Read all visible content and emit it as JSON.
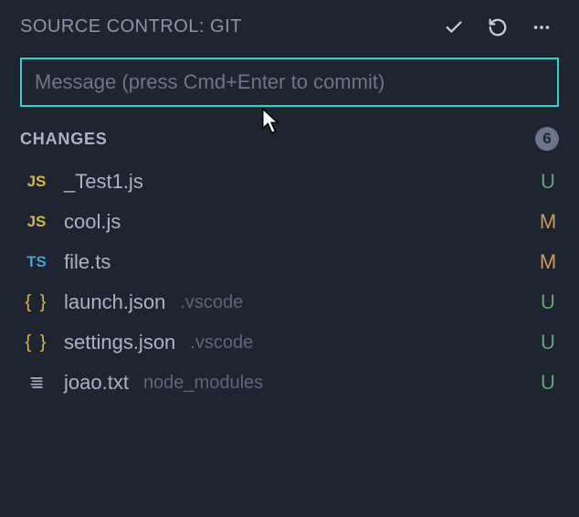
{
  "header": {
    "title": "SOURCE CONTROL: GIT"
  },
  "commit": {
    "placeholder": "Message (press Cmd+Enter to commit)",
    "value": ""
  },
  "changes": {
    "title": "CHANGES",
    "count": "6",
    "files": [
      {
        "icon": "JS",
        "iconType": "js",
        "name": "_Test1.js",
        "path": "",
        "status": "U",
        "statusType": "u"
      },
      {
        "icon": "JS",
        "iconType": "js",
        "name": "cool.js",
        "path": "",
        "status": "M",
        "statusType": "m"
      },
      {
        "icon": "TS",
        "iconType": "ts",
        "name": "file.ts",
        "path": "",
        "status": "M",
        "statusType": "m"
      },
      {
        "icon": "{ }",
        "iconType": "json",
        "name": "launch.json",
        "path": ".vscode",
        "status": "U",
        "statusType": "u"
      },
      {
        "icon": "{ }",
        "iconType": "json",
        "name": "settings.json",
        "path": ".vscode",
        "status": "U",
        "statusType": "u"
      },
      {
        "icon": "",
        "iconType": "text",
        "name": "joao.txt",
        "path": "node_modules",
        "status": "U",
        "statusType": "u"
      }
    ]
  }
}
